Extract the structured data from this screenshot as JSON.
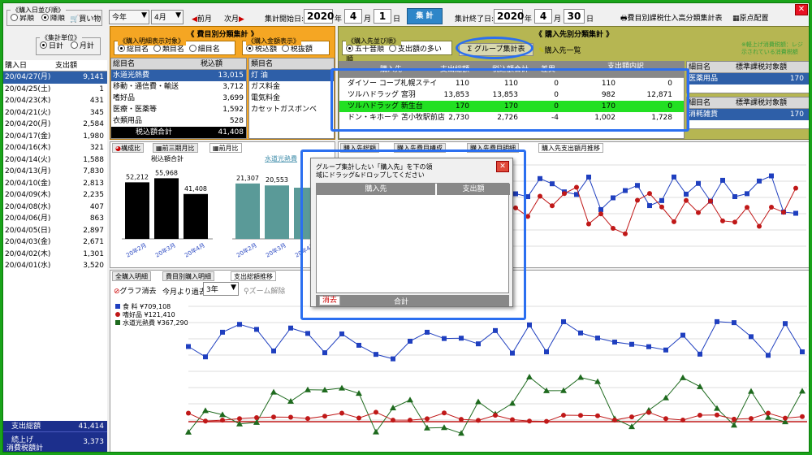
{
  "sort_group": {
    "title": "《購入日並び順》",
    "opt1": "昇順",
    "opt2": "降順"
  },
  "buy_label": "買い物",
  "year_sel": "今年",
  "month_sel": "4月",
  "prev_month": "前月",
  "next_month": "次月",
  "start": {
    "label": "集計開始日:",
    "year": "2020",
    "y": "年",
    "month": "4",
    "m": "月",
    "day": "1",
    "d": "日"
  },
  "calc_btn": "集 計",
  "end": {
    "label": "集計終了日:",
    "year": "2020",
    "y": "年",
    "month": "4",
    "m": "月",
    "day": "30",
    "d": "日"
  },
  "tax_btn": "費目別課税仕入高分類集計表",
  "layout_btn": "原点配置",
  "unit_group": {
    "title": "《集計単位》",
    "opt1": "日計",
    "opt2": "月計"
  },
  "left_table": {
    "col1": "購入日",
    "col2": "支出額",
    "rows": [
      {
        "d": "20/04/27(月)",
        "v": "9,141"
      },
      {
        "d": "20/04/25(土)",
        "v": "1"
      },
      {
        "d": "20/04/23(木)",
        "v": "431"
      },
      {
        "d": "20/04/21(火)",
        "v": "345"
      },
      {
        "d": "20/04/20(月)",
        "v": "2,584"
      },
      {
        "d": "20/04/17(金)",
        "v": "1,980"
      },
      {
        "d": "20/04/16(木)",
        "v": "321"
      },
      {
        "d": "20/04/14(火)",
        "v": "1,588"
      },
      {
        "d": "20/04/13(月)",
        "v": "7,830"
      },
      {
        "d": "20/04/10(金)",
        "v": "2,813"
      },
      {
        "d": "20/04/09(木)",
        "v": "2,235"
      },
      {
        "d": "20/04/08(水)",
        "v": "407"
      },
      {
        "d": "20/04/06(月)",
        "v": "863"
      },
      {
        "d": "20/04/05(日)",
        "v": "2,897"
      },
      {
        "d": "20/04/03(金)",
        "v": "2,671"
      },
      {
        "d": "20/04/02(木)",
        "v": "1,301"
      },
      {
        "d": "20/04/01(水)",
        "v": "3,520"
      }
    ],
    "total_label": "支出総額",
    "total": "41,414",
    "tax_label1": "続上げ",
    "tax_label2": "消費税額計",
    "tax": "3,373"
  },
  "cat_panel": {
    "title": "《 費目別分類集計 》",
    "target_title": "《購入明細表示対象》",
    "t1": "総目名",
    "t2": "類目名",
    "t3": "細目名",
    "amount_title": "《購入金額表示》",
    "a1": "税込額",
    "a2": "税抜額",
    "col1": "総目名",
    "col2": "税込額",
    "col3": "類目名",
    "rows": [
      {
        "n": "水道光熱費",
        "v": "13,015"
      },
      {
        "n": "移動・通信費・輸送",
        "v": "3,712"
      },
      {
        "n": "嗜好品",
        "v": "3,699"
      },
      {
        "n": "医療・医薬等",
        "v": "1,592"
      },
      {
        "n": "衣類用品",
        "v": "528"
      }
    ],
    "sub_rows": [
      "灯 油",
      "ガス料金",
      "電気料金",
      "カセットガスボンベ"
    ],
    "total_label": "税込額合計",
    "total": "41,408"
  },
  "shop_panel": {
    "title": "《 購入先別分類集計 》",
    "order_title": "《購入先並び順》",
    "o1": "五十音順",
    "o2": "支出額の多い順",
    "group_btn": "グループ集計表",
    "list_btn": "購入先一覧",
    "col_shop": "購入先",
    "col_sp": "支出総額",
    "col_tax": "税込額合計",
    "col_diff": "差異",
    "col_detail": "支出額内訳",
    "rows": [
      {
        "n": "ダイソー コープ札幌ステイ",
        "a": "110",
        "b": "110",
        "c": "0",
        "d": "110",
        "e": "0"
      },
      {
        "n": "ツルハドラッグ 宮羽",
        "a": "13,853",
        "b": "13,853",
        "c": "0",
        "d": "982",
        "e": "12,871"
      },
      {
        "n": "ツルハドラッグ 新生台",
        "a": "170",
        "b": "170",
        "c": "0",
        "d": "170",
        "e": "0"
      },
      {
        "n": "ドン・キホーテ 苫小牧駅前店",
        "a": "2,730",
        "b": "2,726",
        "c": "-4",
        "d": "1,002",
        "e": "1,728"
      }
    ],
    "right_col1": "細目名",
    "right_col2": "標準課税対象額",
    "right_cat": "医薬用品",
    "right_val": "170",
    "right2_cat": "消耗雑貨",
    "right2_val": "170",
    "note": "※軽上げ消費税額：レジ 示されている消費税額"
  },
  "mid_tabs": {
    "t1": "構成比",
    "t2": "前三期月比",
    "t3": "前月比"
  },
  "bar_chart": {
    "title": "税込額合計",
    "subtitle": "水道光熱費"
  },
  "right_tabs": {
    "t1": "購入先総額",
    "t2": "購入先費目構成",
    "t3": "購入先費目明細",
    "t4": "購入先支出額月推移"
  },
  "bottom_tabs": {
    "t1": "全購入明細",
    "t2": "費目別購入明細",
    "t3": "支出総額推移"
  },
  "bottom_controls": {
    "graph_clear": "グラフ消去",
    "period": "今月より過去",
    "years": "3年",
    "zoom_reset": "ズーム解除"
  },
  "legend": [
    {
      "label": "食 料 ¥709,108",
      "color": "#1f3fbf"
    },
    {
      "label": "嗜好品 ¥121,410",
      "color": "#c01818"
    },
    {
      "label": "水道光熱費 ¥367,290",
      "color": "#1e6a1e"
    }
  ],
  "dialog": {
    "msg1": "グループ集計したい「購入先」を下の領",
    "msg2": "域にドラッグ&ドロップしてください",
    "col1": "購入先",
    "col2": "支出額",
    "clear": "消去",
    "total": "合計"
  },
  "chart_data": [
    {
      "type": "bar",
      "title": "税込額合計",
      "categories": [
        "20年2月",
        "20年3月",
        "20年4月"
      ],
      "values": [
        52212,
        55968,
        41408
      ]
    },
    {
      "type": "bar",
      "title": "水道光熱費",
      "categories": [
        "20年2月",
        "20年3月",
        "20年4月"
      ],
      "values": [
        21307,
        20553,
        null
      ]
    },
    {
      "type": "line",
      "series": [
        {
          "name": "食 料 ¥709,108",
          "color": "#1f3fbf",
          "marker": "square",
          "values": []
        },
        {
          "name": "嗜好品 ¥121,410",
          "color": "#c01818",
          "marker": "circle",
          "values": []
        },
        {
          "name": "水道光熱費 ¥367,290",
          "color": "#1e6a1e",
          "marker": "triangle",
          "values": []
        }
      ]
    }
  ],
  "colors": {
    "accent_orange": "#f5a623",
    "accent_olive": "#b6b652",
    "frame": "#2b6ff0",
    "window": "#1aa31a"
  }
}
